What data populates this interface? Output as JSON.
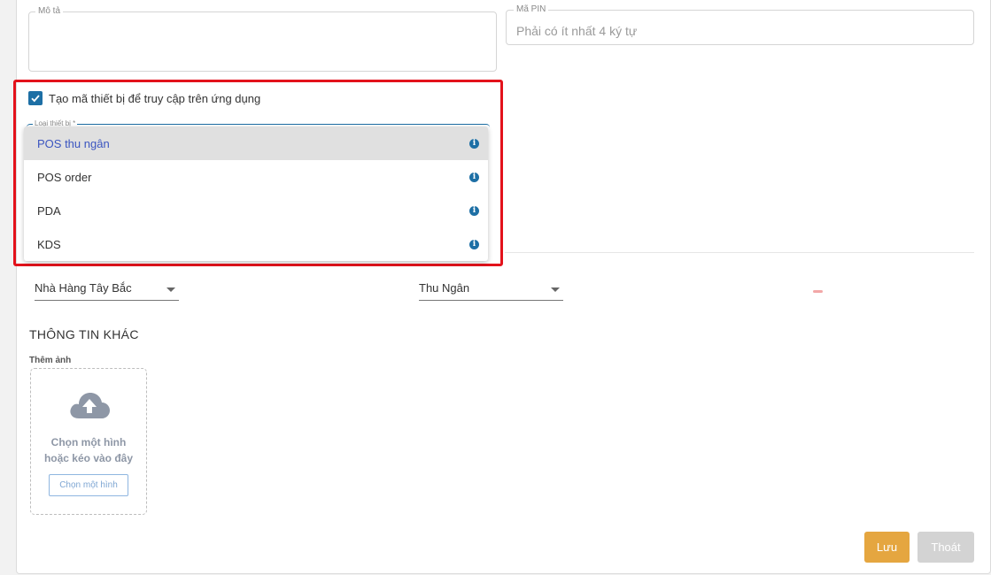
{
  "form": {
    "description": {
      "label": "Mô tả",
      "value": ""
    },
    "pin": {
      "label": "Mã PIN",
      "placeholder": "Phải có ít nhất 4 ký tự"
    },
    "create_device_code": {
      "label": "Tạo mã thiết bị để truy cập trên ứng dụng",
      "checked": true
    },
    "device_type": {
      "label": "Loại thiết bị *",
      "options": [
        {
          "label": "POS thu ngân",
          "selected": true
        },
        {
          "label": "POS order",
          "selected": false
        },
        {
          "label": "PDA",
          "selected": false
        },
        {
          "label": "KDS",
          "selected": false
        }
      ]
    },
    "restaurant_select": {
      "value": "Nhà Hàng Tây Bắc"
    },
    "role_select": {
      "value": "Thu Ngân"
    }
  },
  "other_info": {
    "title": "THÔNG TIN KHÁC",
    "add_photo_label": "Thêm ảnh",
    "drop_line1": "Chọn một hình",
    "drop_line2": "hoặc kéo vào đây",
    "choose_button": "Chọn một hình"
  },
  "actions": {
    "save_label": "Lưu",
    "exit_label": "Thoát"
  },
  "colors": {
    "accent": "#1d6fa5",
    "highlight_border": "#e3121b",
    "save_button": "#e5a640",
    "exit_button": "#d3d3d3"
  },
  "icons": {
    "checkbox": "check-icon",
    "option_info": "info-icon",
    "upload": "cloud-upload-icon",
    "select_caret": "caret-down-icon"
  }
}
